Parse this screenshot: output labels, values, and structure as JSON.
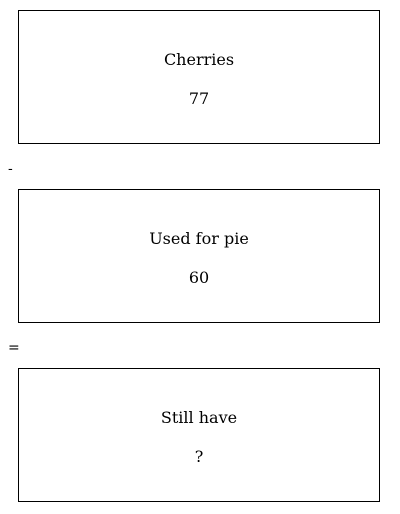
{
  "boxes": [
    {
      "label": "Cherries",
      "value": "77"
    },
    {
      "label": "Used for pie",
      "value": "60"
    },
    {
      "label": "Still have",
      "value": "?"
    }
  ],
  "operators": {
    "minus": "-",
    "equals": "="
  }
}
